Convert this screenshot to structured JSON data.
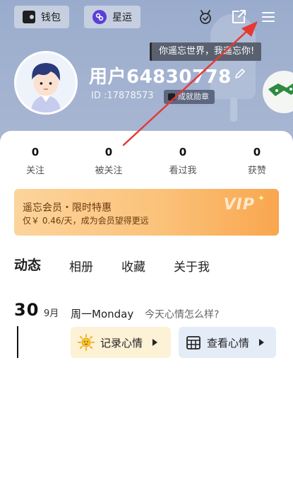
{
  "header": {
    "wallet_label": "钱包",
    "horoscope_label": "星运",
    "bubble_text": "你遥忘世界，我遥忘你!"
  },
  "profile": {
    "username": "用户64830778",
    "id_text": "ID :17878573",
    "badge_label": "成就勋章"
  },
  "stats": [
    {
      "value": "0",
      "label": "关注"
    },
    {
      "value": "0",
      "label": "被关注"
    },
    {
      "value": "0",
      "label": "看过我"
    },
    {
      "value": "0",
      "label": "获赞"
    }
  ],
  "vip": {
    "title": "遥忘会员・限时特惠",
    "subtitle": "仅￥ 0.46/天，成为会员望得更远",
    "logo": "VIP"
  },
  "tabs": [
    {
      "label": "动态",
      "active": true
    },
    {
      "label": "相册",
      "active": false
    },
    {
      "label": "收藏",
      "active": false
    },
    {
      "label": "关于我",
      "active": false
    }
  ],
  "feed": {
    "day": "30",
    "month": "9月",
    "weekday": "周一Monday",
    "prompt": "今天心情怎么样?",
    "record_button": "记录心情",
    "view_button": "查看心情"
  },
  "colors": {
    "header_bg": "#9aaccd",
    "vip_gradient_start": "#fcd49c",
    "vip_gradient_end": "#f9a64e",
    "active_tab_highlight": "#e7ff4c",
    "annotation_arrow": "#e53935"
  },
  "icons": [
    "wallet-icon",
    "horoscope-icon",
    "achievement-icon",
    "share-icon",
    "menu-icon",
    "edit-icon",
    "sun-icon",
    "calendar-icon"
  ]
}
